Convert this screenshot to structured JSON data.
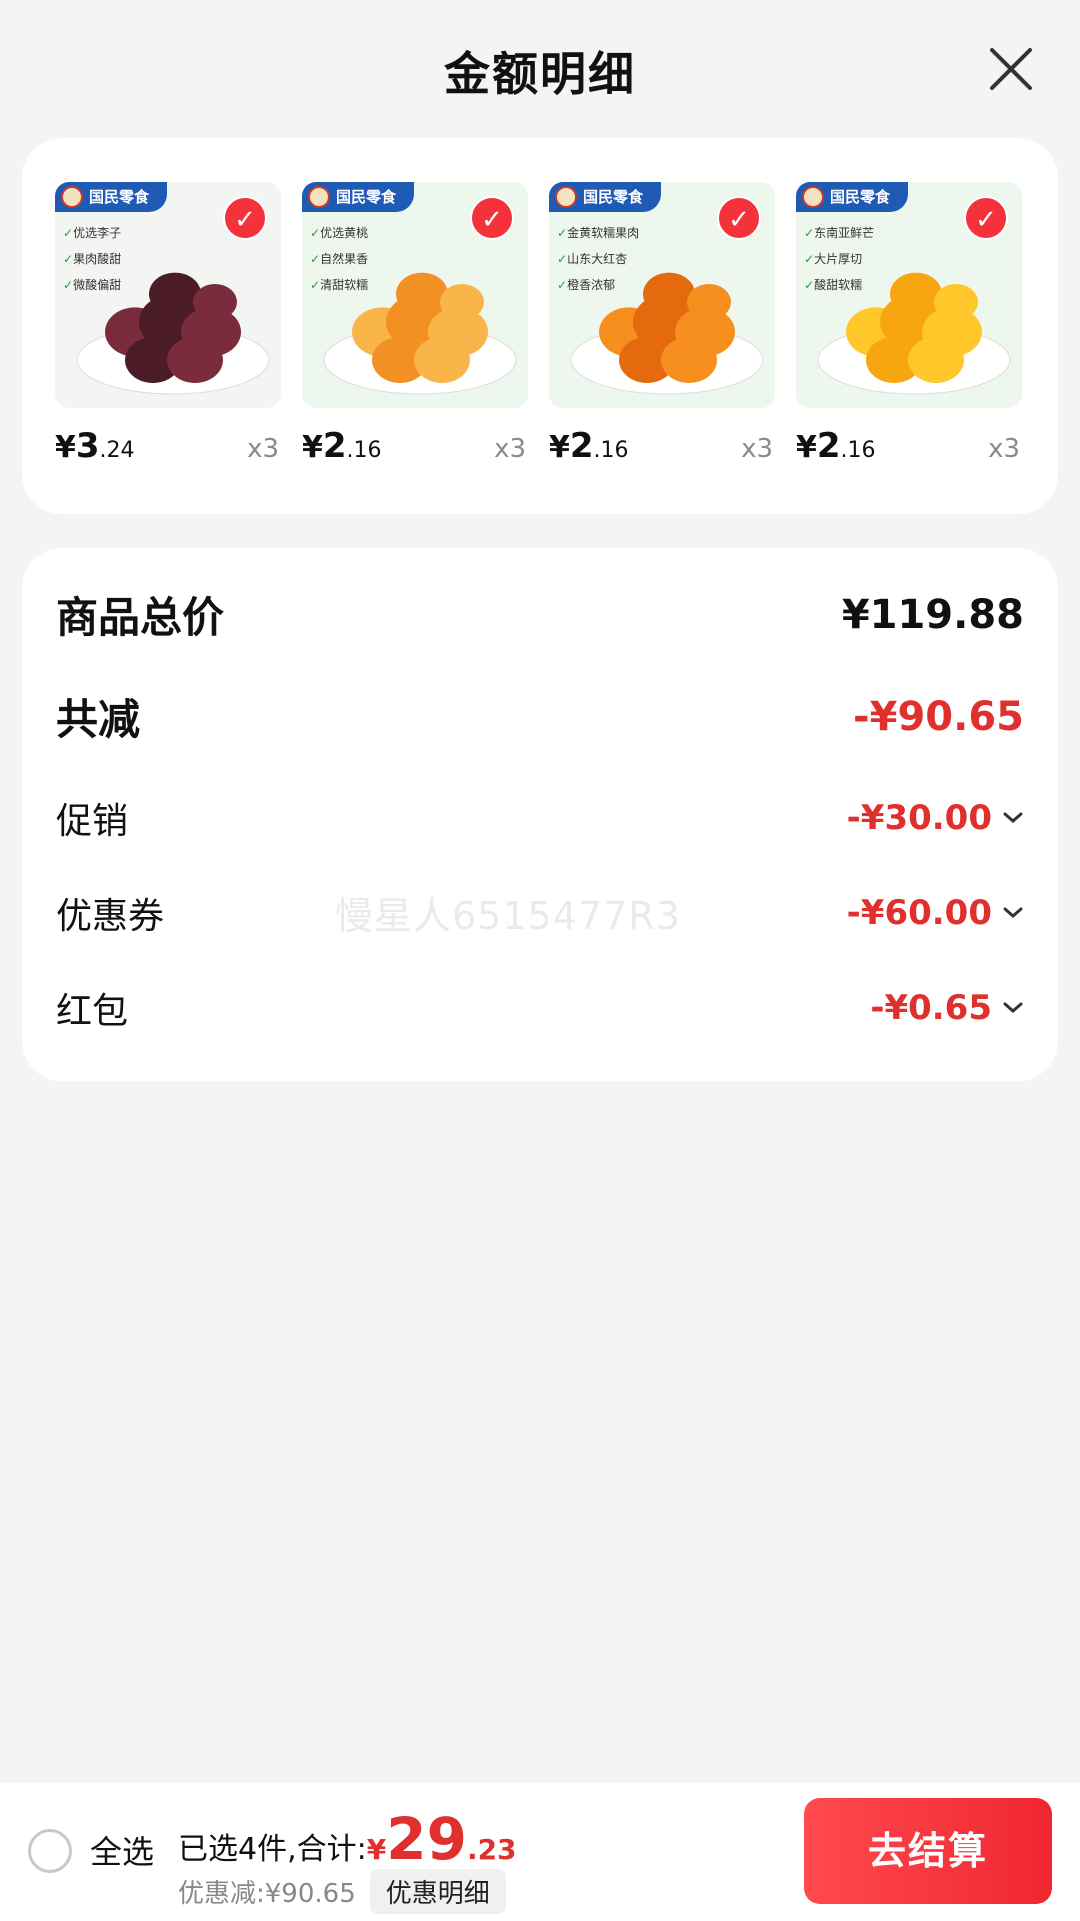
{
  "header": {
    "title": "金额明细",
    "close_icon": "close-icon"
  },
  "products": [
    {
      "brand": "国民零食",
      "features": [
        "优选李子",
        "果肉酸甜",
        "微酸偏甜"
      ],
      "price_currency": "¥",
      "price_int": "3",
      "price_dec": ".24",
      "qty": "x3",
      "colors": [
        "#7b2c3c",
        "#4b1b27"
      ],
      "bg": "#f3f5f3",
      "selected": true
    },
    {
      "brand": "国民零食",
      "features": [
        "优选黄桃",
        "自然果香",
        "清甜软糯"
      ],
      "price_currency": "¥",
      "price_int": "2",
      "price_dec": ".16",
      "qty": "x3",
      "colors": [
        "#f9b54a",
        "#f39024"
      ],
      "bg": "#eef7ee",
      "selected": true
    },
    {
      "brand": "国民零食",
      "features": [
        "金黄软糯果肉",
        "山东大红杏",
        "橙香浓郁"
      ],
      "price_currency": "¥",
      "price_int": "2",
      "price_dec": ".16",
      "qty": "x3",
      "colors": [
        "#f68f1e",
        "#e46a0d"
      ],
      "bg": "#eef7ee",
      "selected": true
    },
    {
      "brand": "国民零食",
      "features": [
        "东南亚鲜芒",
        "大片厚切",
        "酸甜软糯"
      ],
      "price_currency": "¥",
      "price_int": "2",
      "price_dec": ".16",
      "qty": "x3",
      "colors": [
        "#ffc72a",
        "#f7a612"
      ],
      "bg": "#eef7ee",
      "selected": true
    }
  ],
  "amounts": {
    "total_label": "商品总价",
    "total_value": "¥119.88",
    "reduce_label": "共减",
    "reduce_value": "-¥90.65",
    "promo_label": "促销",
    "promo_value": "-¥30.00",
    "coupon_label": "优惠券",
    "coupon_value": "-¥60.00",
    "redpacket_label": "红包",
    "redpacket_value": "-¥0.65"
  },
  "watermark": "慢星人6515477R3",
  "bottom_bar": {
    "select_all_label": "全选",
    "selected_summary": "已选4件,合计:",
    "total_currency": "¥",
    "total_int": "29",
    "total_dec": ".23",
    "discount_text": "优惠减:¥90.65",
    "detail_button": "优惠明细",
    "checkout_button": "去结算"
  },
  "colors": {
    "accent_red": "#e0302d",
    "checkout_red": "#f0262f",
    "background": "#f4f4f4"
  }
}
